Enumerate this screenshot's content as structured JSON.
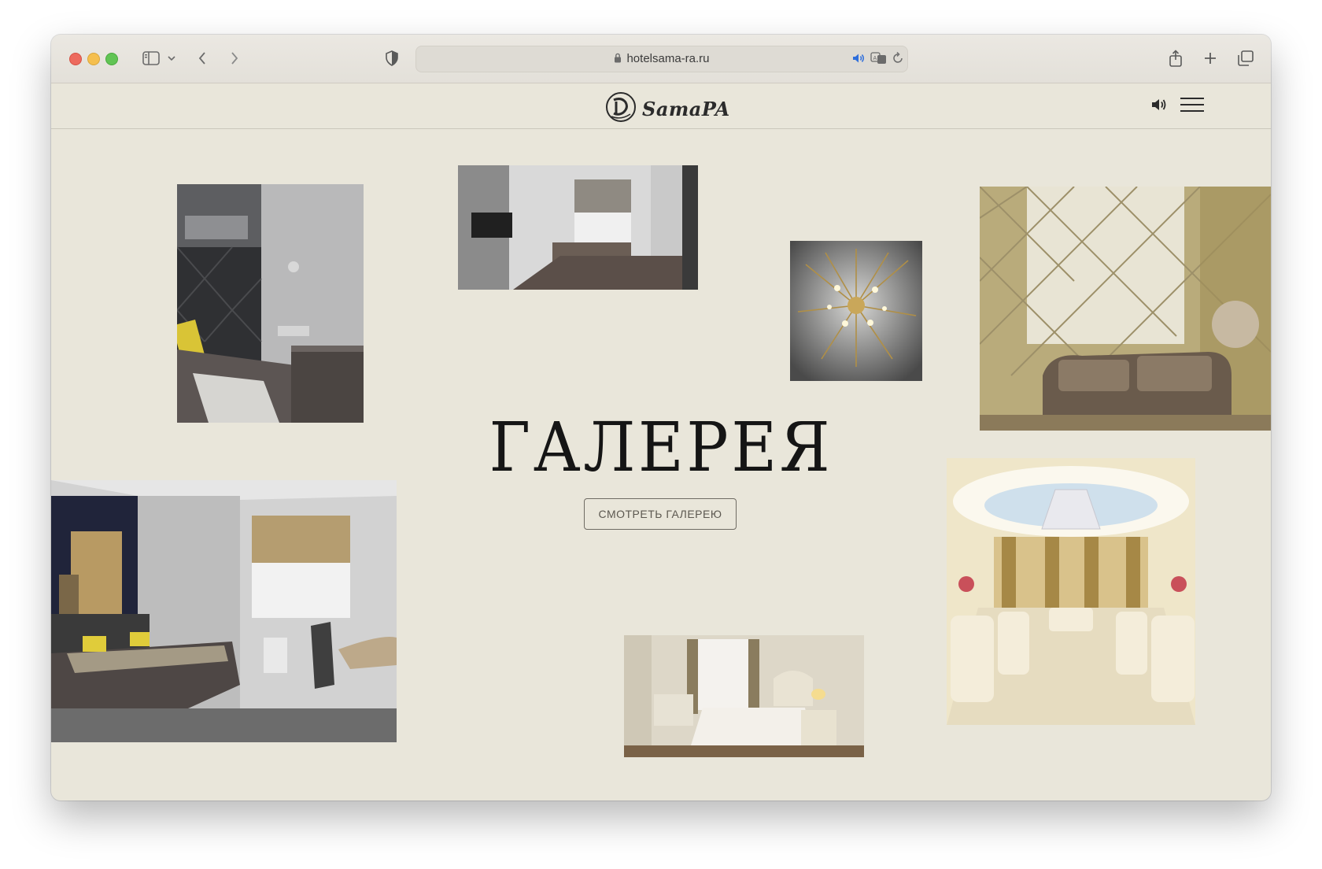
{
  "browser": {
    "url": "hotelsama-ra.ru",
    "icons": [
      "sidebar-icon",
      "chevron-down-icon",
      "back-icon",
      "forward-icon",
      "shield-icon",
      "lock-icon",
      "speaker-icon",
      "translate-icon",
      "reload-icon",
      "share-icon",
      "new-tab-icon",
      "tabs-overview-icon"
    ]
  },
  "header": {
    "logo_text": "SamaPA",
    "icons": [
      "logo-emblem-icon",
      "sound-icon",
      "menu-icon"
    ]
  },
  "gallery": {
    "title": "ГАЛЕРЕЯ",
    "button_label": "СМОТРЕТЬ ГАЛЕРЕЮ",
    "photos": [
      "hotel room with grey headboard",
      "room with desk and tv",
      "crystal chandelier",
      "lounge with curtains and sofa",
      "double room with city mural",
      "suite bedroom with lamp",
      "banquet hall"
    ]
  }
}
